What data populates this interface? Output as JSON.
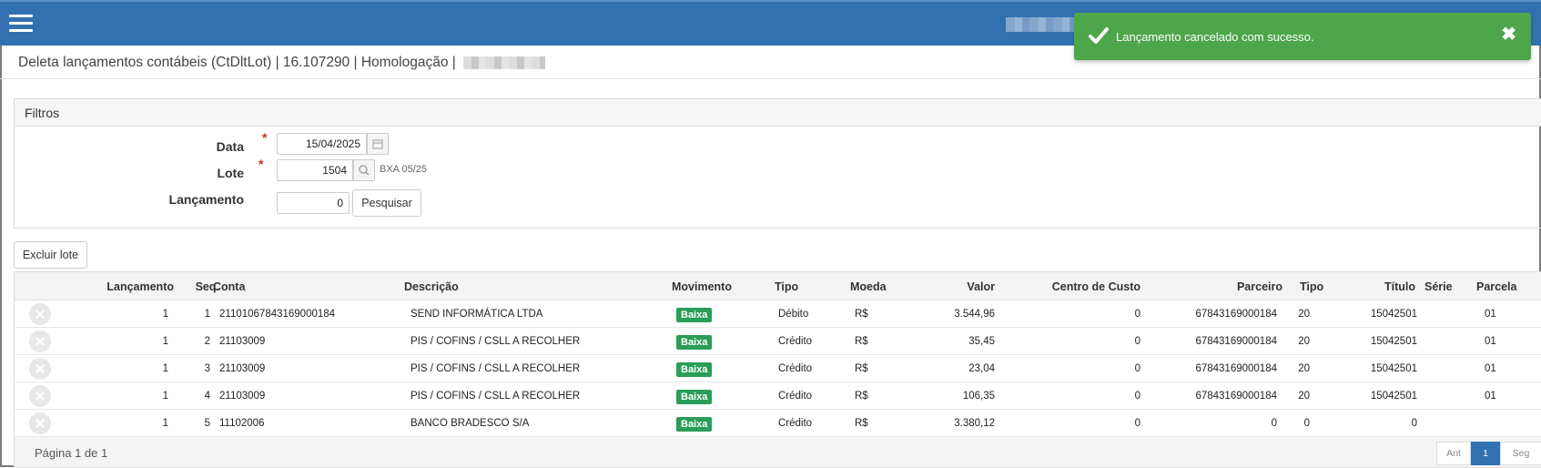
{
  "header": {
    "menu_icon": "hamburger-icon"
  },
  "toast": {
    "message": "Lançamento cancelado com sucesso.",
    "close": "✖",
    "color": "#4ea64b"
  },
  "page": {
    "title": "Deleta lançamentos contábeis (CtDltLot) | 16.107290 | Homologação |"
  },
  "filters": {
    "title": "Filtros",
    "data_label": "Data",
    "data_value": "15/04/2025",
    "lote_label": "Lote",
    "lote_value": "1504",
    "lote_hint": "BXA 05/25",
    "lanc_label": "Lançamento",
    "lanc_value": "0",
    "search_label": "Pesquisar",
    "required_mark": "*"
  },
  "actions": {
    "delete_batch": "Excluir lote"
  },
  "table": {
    "columns": [
      "Lançamento",
      "Seq.",
      "Conta",
      "Descrição",
      "Movimento",
      "Tipo",
      "Moeda",
      "Valor",
      "Centro de Custo",
      "Parceiro",
      "Tipo",
      "Título",
      "Série",
      "Parcela"
    ],
    "rows": [
      {
        "lanc": "1",
        "seq": "1",
        "conta": "21101067843169000184",
        "desc": "SEND INFORMÁTICA LTDA",
        "mov": "Baixa",
        "tipo": "Débito",
        "moeda": "R$",
        "valor": "3.544,96",
        "cc": "0",
        "parceiro": "67843169000184",
        "tipo2": "20",
        "titulo": "15042501",
        "serie": "",
        "parcela": "01"
      },
      {
        "lanc": "1",
        "seq": "2",
        "conta": "21103009",
        "desc": "PIS / COFINS / CSLL A RECOLHER",
        "mov": "Baixa",
        "tipo": "Crédito",
        "moeda": "R$",
        "valor": "35,45",
        "cc": "0",
        "parceiro": "67843169000184",
        "tipo2": "20",
        "titulo": "15042501",
        "serie": "",
        "parcela": "01"
      },
      {
        "lanc": "1",
        "seq": "3",
        "conta": "21103009",
        "desc": "PIS / COFINS / CSLL A RECOLHER",
        "mov": "Baixa",
        "tipo": "Crédito",
        "moeda": "R$",
        "valor": "23,04",
        "cc": "0",
        "parceiro": "67843169000184",
        "tipo2": "20",
        "titulo": "15042501",
        "serie": "",
        "parcela": "01"
      },
      {
        "lanc": "1",
        "seq": "4",
        "conta": "21103009",
        "desc": "PIS / COFINS / CSLL A RECOLHER",
        "mov": "Baixa",
        "tipo": "Crédito",
        "moeda": "R$",
        "valor": "106,35",
        "cc": "0",
        "parceiro": "67843169000184",
        "tipo2": "20",
        "titulo": "15042501",
        "serie": "",
        "parcela": "01"
      },
      {
        "lanc": "1",
        "seq": "5",
        "conta": "11102006",
        "desc": "BANCO BRADESCO S/A",
        "mov": "Baixa",
        "tipo": "Crédito",
        "moeda": "R$",
        "valor": "3.380,12",
        "cc": "0",
        "parceiro": "0",
        "tipo2": "0",
        "titulo": "0",
        "serie": "",
        "parcela": ""
      }
    ]
  },
  "pagination": {
    "info": "Página 1 de 1",
    "prev": "Ant",
    "current": "1",
    "next": "Seg"
  }
}
